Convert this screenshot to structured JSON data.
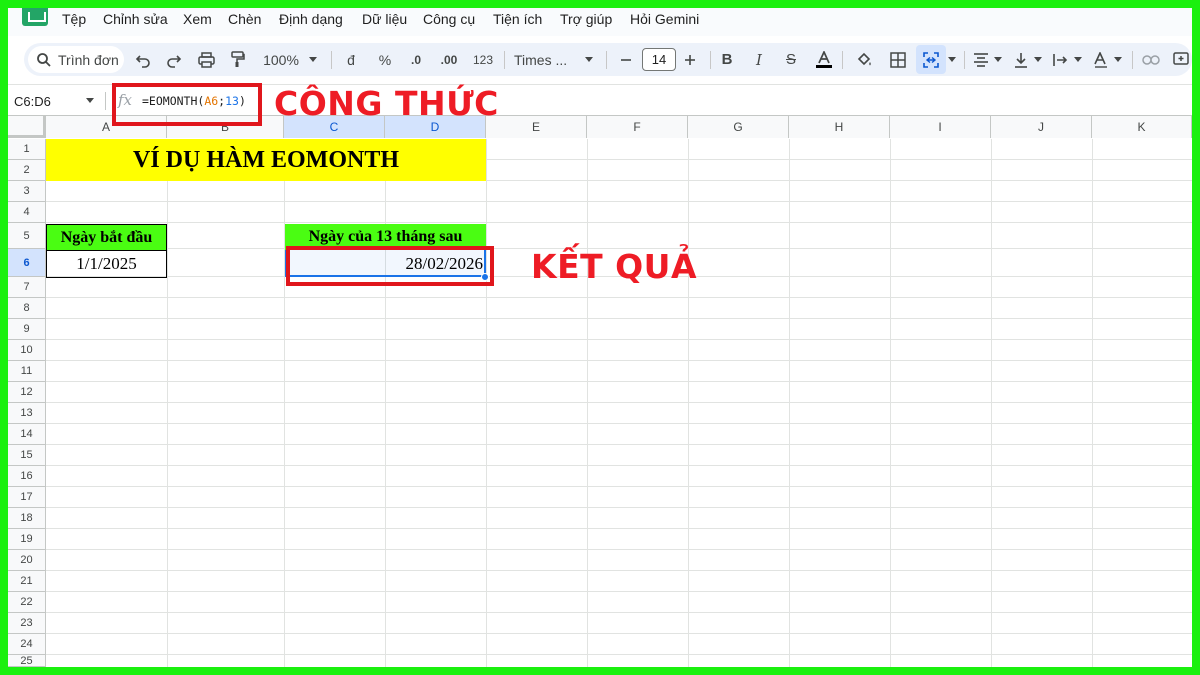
{
  "menu": [
    "Tệp",
    "Chỉnh sửa",
    "Xem",
    "Chèn",
    "Định dạng",
    "Dữ liệu",
    "Công cụ",
    "Tiện ích",
    "Trợ giúp",
    "Hỏi Gemini"
  ],
  "toolbar": {
    "search_label": "Trình đơn",
    "zoom": "100%",
    "currency": "đ",
    "percent": "%",
    "decimal_decrease": ".0",
    "decimal_increase": ".00",
    "number_format": "123",
    "font_name": "Times ...",
    "font_size": "14"
  },
  "formula_bar": {
    "name_box": "C6:D6",
    "fx": "fx",
    "formula_prefix": "=EOMONTH(",
    "formula_ref": "A6",
    "formula_sep": ";",
    "formula_num": "13",
    "formula_suffix": ")"
  },
  "grid": {
    "columns": [
      "A",
      "B",
      "C",
      "D",
      "E",
      "F",
      "G",
      "H",
      "I",
      "J",
      "K"
    ],
    "selected_columns": [
      "C",
      "D"
    ],
    "rows": [
      "1",
      "2",
      "3",
      "4",
      "5",
      "6",
      "7",
      "8",
      "9",
      "10",
      "11",
      "12",
      "13",
      "14",
      "15",
      "16",
      "17",
      "18",
      "19",
      "20",
      "21",
      "22",
      "23",
      "24",
      "25"
    ],
    "selected_row": "6"
  },
  "cells": {
    "title": "VÍ DỤ HÀM EOMONTH",
    "start_label": "Ngày bắt đầu",
    "start_value": "1/1/2025",
    "result_label": "Ngày của 13 tháng sau",
    "result_value": "28/02/2026"
  },
  "annotations": {
    "formula_label": "CÔNG THỨC",
    "result_label": "KẾT QUẢ",
    "highlight_color": "#ee1c25"
  },
  "colors": {
    "frame": "#1bf00f",
    "title_fill": "#ffff00",
    "header_fill": "#4afd12",
    "selection": "#1a73e8"
  }
}
